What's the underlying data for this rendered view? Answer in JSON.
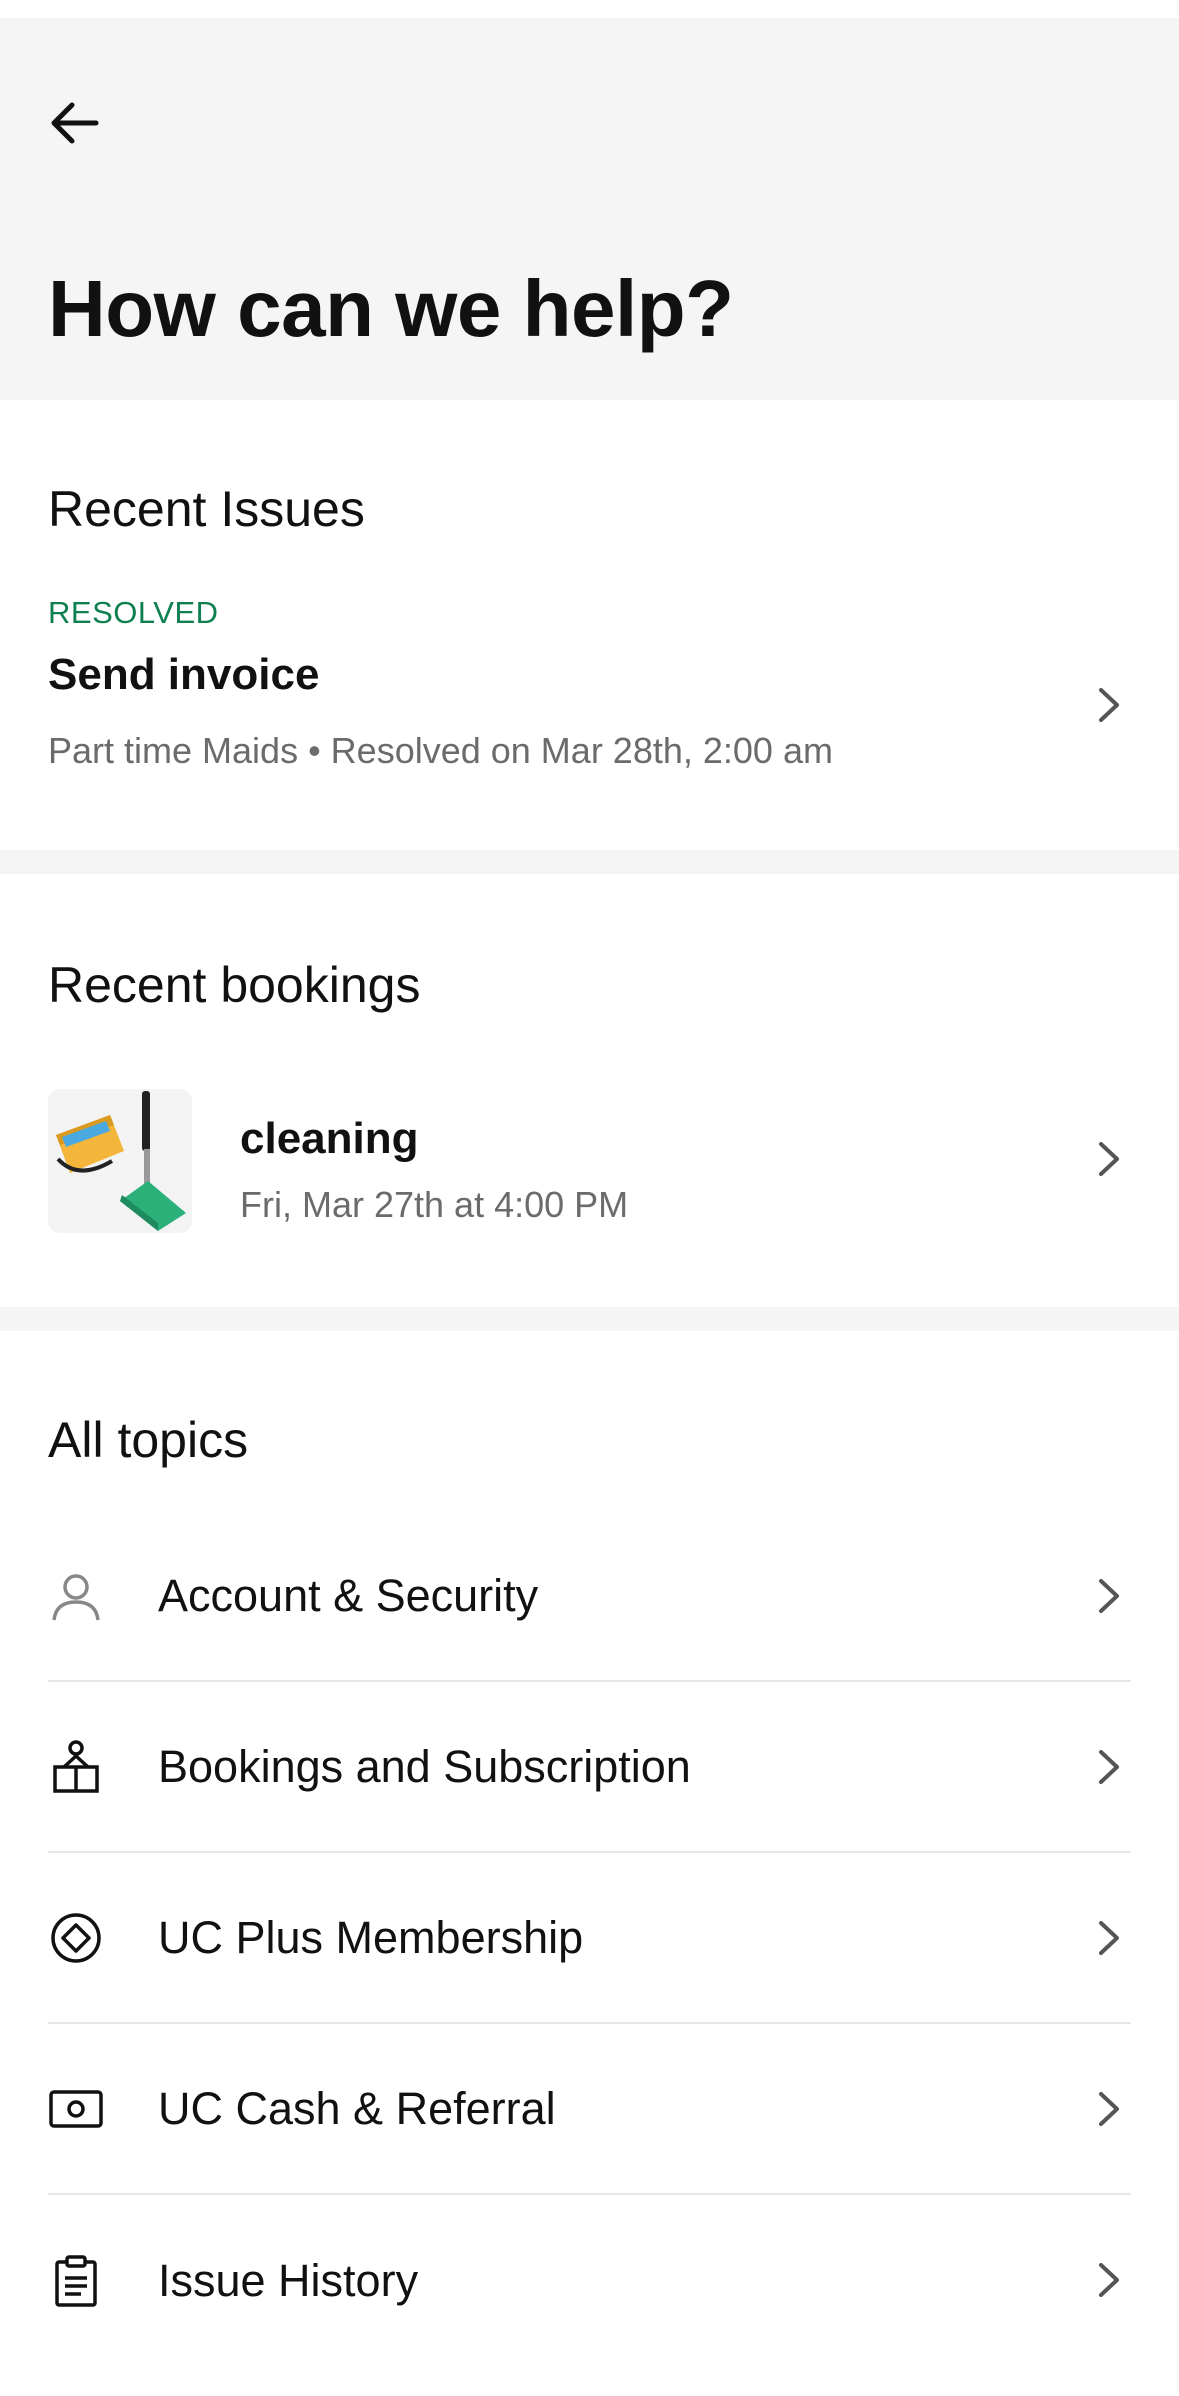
{
  "header": {
    "back_icon": "arrow-left-icon",
    "title": "How can we help?"
  },
  "recent_issues": {
    "title": "Recent Issues",
    "items": [
      {
        "status": "RESOLVED",
        "name": "Send invoice",
        "meta": "Part time Maids • Resolved on Mar 28th, 2:00 am"
      }
    ]
  },
  "recent_bookings": {
    "title": "Recent bookings",
    "items": [
      {
        "name": "cleaning",
        "time": "Fri, Mar 27th at 4:00 PM",
        "thumbnail": "cleaning-tools-image"
      }
    ]
  },
  "all_topics": {
    "title": "All topics",
    "items": [
      {
        "label": "Account & Security",
        "icon": "user-icon"
      },
      {
        "label": "Bookings and Subscription",
        "icon": "booking-icon"
      },
      {
        "label": "UC Plus Membership",
        "icon": "diamond-icon"
      },
      {
        "label": "UC Cash & Referral",
        "icon": "cash-icon"
      },
      {
        "label": "Issue History",
        "icon": "clipboard-icon"
      }
    ]
  },
  "colors": {
    "resolved": "#0e7f4f",
    "header_bg": "#f5f5f5",
    "muted_text": "#6b6b6b"
  }
}
